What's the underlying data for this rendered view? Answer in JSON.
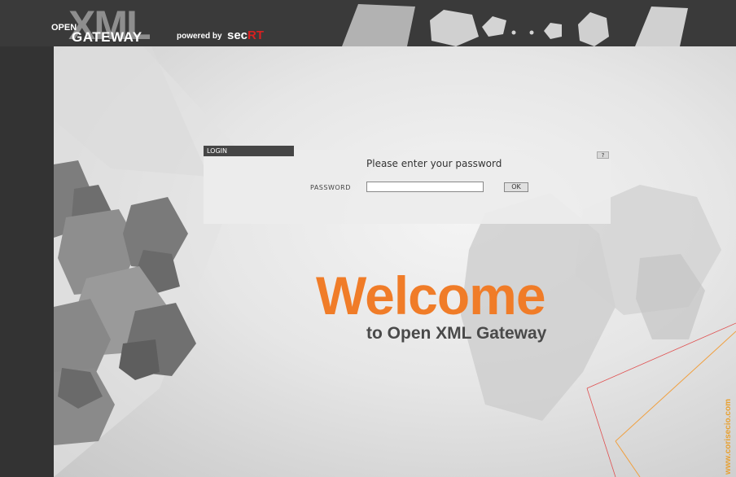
{
  "header": {
    "logo_open": "OPEN",
    "logo_xml": "XML",
    "logo_gateway": "GATEWAY",
    "powered_by": "powered by",
    "brand_sec": "sec",
    "brand_rt": "RT"
  },
  "login": {
    "tab_label": "LOGIN",
    "help_label": "?",
    "prompt": "Please enter your password",
    "password_label": "PASSWORD",
    "password_value": "",
    "ok_label": "OK"
  },
  "welcome": {
    "title": "Welcome",
    "subtitle": "to Open XML Gateway"
  },
  "footer": {
    "website": "www.corisecio.com"
  },
  "colors": {
    "accent_orange": "#f07c28",
    "header_dark": "#3a3a3a",
    "brand_red": "#d82020"
  },
  "icons": {
    "help": "help-icon"
  }
}
